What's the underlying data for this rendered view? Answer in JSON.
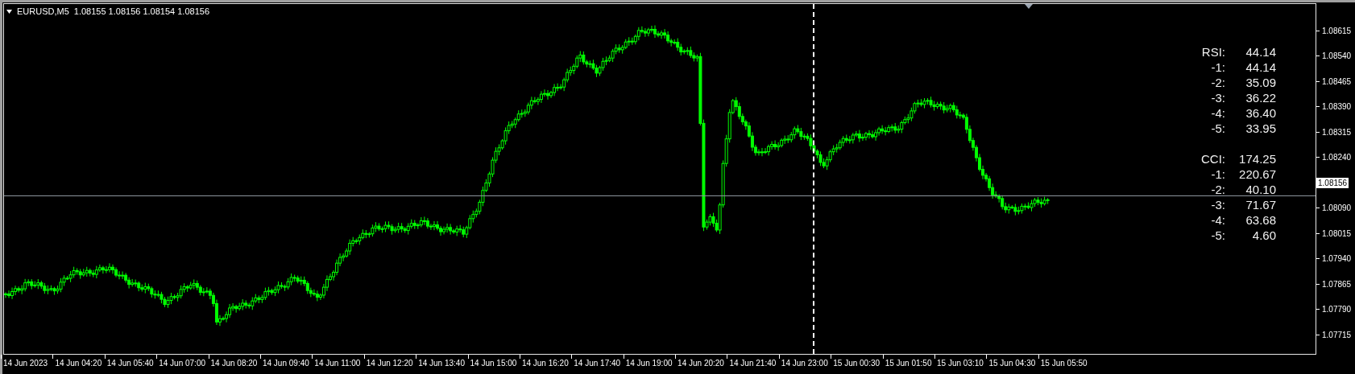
{
  "chart": {
    "symbol": "EURUSD,M5",
    "ohlc": "1.08155 1.08156 1.08154 1.08156"
  },
  "indicators": [
    {
      "lines": [
        {
          "label": "RSI:",
          "value": "44.14"
        },
        {
          "label": "-1:",
          "value": "44.14"
        },
        {
          "label": "-2:",
          "value": "35.09"
        },
        {
          "label": "-3:",
          "value": "36.22"
        },
        {
          "label": "-4:",
          "value": "36.40"
        },
        {
          "label": "-5:",
          "value": "33.95"
        }
      ]
    },
    {
      "lines": [
        {
          "label": "CCI:",
          "value": "174.25"
        },
        {
          "label": "-1:",
          "value": "220.67"
        },
        {
          "label": "-2:",
          "value": "40.10"
        },
        {
          "label": "-3:",
          "value": "71.67"
        },
        {
          "label": "-4:",
          "value": "63.68"
        },
        {
          "label": "-5:",
          "value": "4.60"
        }
      ]
    }
  ],
  "price_axis": {
    "ticks_above": [
      "1.08615",
      "1.08540",
      "1.08465",
      "1.08390",
      "1.08315",
      "1.08240"
    ],
    "current_price": "1.08156",
    "ticks_below": [
      "1.08090",
      "1.08015",
      "1.07940",
      "1.07865",
      "1.07790",
      "1.07715"
    ]
  },
  "time_axis": {
    "labels": [
      "14 Jun 2023",
      "14 Jun 04:20",
      "14 Jun 05:40",
      "14 Jun 07:00",
      "14 Jun 08:20",
      "14 Jun 09:40",
      "14 Jun 11:00",
      "14 Jun 12:20",
      "14 Jun 13:40",
      "14 Jun 15:00",
      "14 Jun 16:20",
      "14 Jun 17:40",
      "14 Jun 19:00",
      "14 Jun 20:20",
      "14 Jun 21:40",
      "14 Jun 23:00",
      "15 Jun 00:30",
      "15 Jun 01:50",
      "15 Jun 03:10",
      "15 Jun 04:30",
      "15 Jun 05:50"
    ]
  }
}
